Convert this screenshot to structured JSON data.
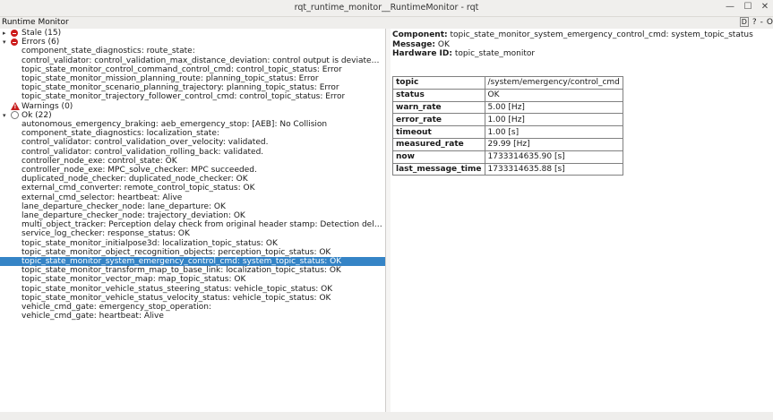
{
  "window": {
    "title": "rqt_runtime_monitor__RuntimeMonitor - rqt",
    "minimize": "—",
    "maximize": "☐",
    "close": "✕"
  },
  "menubar": {
    "plugin_label": "Runtime Monitor",
    "d_label": "D",
    "help_label": "?",
    "minus_label": "-",
    "close_label": "O"
  },
  "tree": {
    "stale": {
      "label": "Stale (15)"
    },
    "errors": {
      "label": "Errors (6)",
      "items": [
        "component_state_diagnostics: route_state:",
        "control_validator: control_validation_max_distance_deviation: control output is deviated from tr...",
        "topic_state_monitor_control_command_control_cmd: control_topic_status: Error",
        "topic_state_monitor_mission_planning_route: planning_topic_status: Error",
        "topic_state_monitor_scenario_planning_trajectory: planning_topic_status: Error",
        "topic_state_monitor_trajectory_follower_control_cmd: control_topic_status: Error"
      ]
    },
    "warnings": {
      "label": "Warnings (0)"
    },
    "ok": {
      "label": "Ok (22)",
      "items": [
        "autonomous_emergency_braking: aeb_emergency_stop: [AEB]: No Collision",
        "component_state_diagnostics: localization_state:",
        "control_validator: control_validation_over_velocity: validated.",
        "control_validator: control_validation_rolling_back: validated.",
        "controller_node_exe: control_state: OK",
        "controller_node_exe: MPC_solve_checker: MPC succeeded.",
        "duplicated_node_checker: duplicated_node_checker: OK",
        "external_cmd_converter: remote_control_topic_status: OK",
        "external_cmd_selector: heartbeat: Alive",
        "lane_departure_checker_node: lane_departure: OK",
        "lane_departure_checker_node: trajectory_deviation: OK",
        "multi_object_tracker: Perception delay check from original header stamp: Detection delay is acc...",
        "service_log_checker: response_status: OK",
        "topic_state_monitor_initialpose3d: localization_topic_status: OK",
        "topic_state_monitor_object_recognition_objects: perception_topic_status: OK",
        "topic_state_monitor_system_emergency_control_cmd: system_topic_status: OK",
        "topic_state_monitor_transform_map_to_base_link: localization_topic_status: OK",
        "topic_state_monitor_vector_map: map_topic_status: OK",
        "topic_state_monitor_vehicle_status_steering_status: vehicle_topic_status: OK",
        "topic_state_monitor_vehicle_status_velocity_status: vehicle_topic_status: OK",
        "vehicle_cmd_gate: emergency_stop_operation:",
        "vehicle_cmd_gate: heartbeat: Alive"
      ],
      "selected_index": 15
    }
  },
  "detail": {
    "component_label": "Component:",
    "component_value": "topic_state_monitor_system_emergency_control_cmd: system_topic_status",
    "message_label": "Message:",
    "message_value": "OK",
    "hardware_label": "Hardware ID:",
    "hardware_value": "topic_state_monitor",
    "table": [
      {
        "key": "topic",
        "value": "/system/emergency/control_cmd"
      },
      {
        "key": "status",
        "value": "OK"
      },
      {
        "key": "warn_rate",
        "value": "5.00 [Hz]"
      },
      {
        "key": "error_rate",
        "value": "1.00 [Hz]"
      },
      {
        "key": "timeout",
        "value": "1.00 [s]"
      },
      {
        "key": "measured_rate",
        "value": "29.99 [Hz]"
      },
      {
        "key": "now",
        "value": "1733314635.90 [s]"
      },
      {
        "key": "last_message_time",
        "value": "1733314635.88 [s]"
      }
    ]
  },
  "colors": {
    "selection": "#3584c6",
    "error": "#cc1b1b"
  }
}
